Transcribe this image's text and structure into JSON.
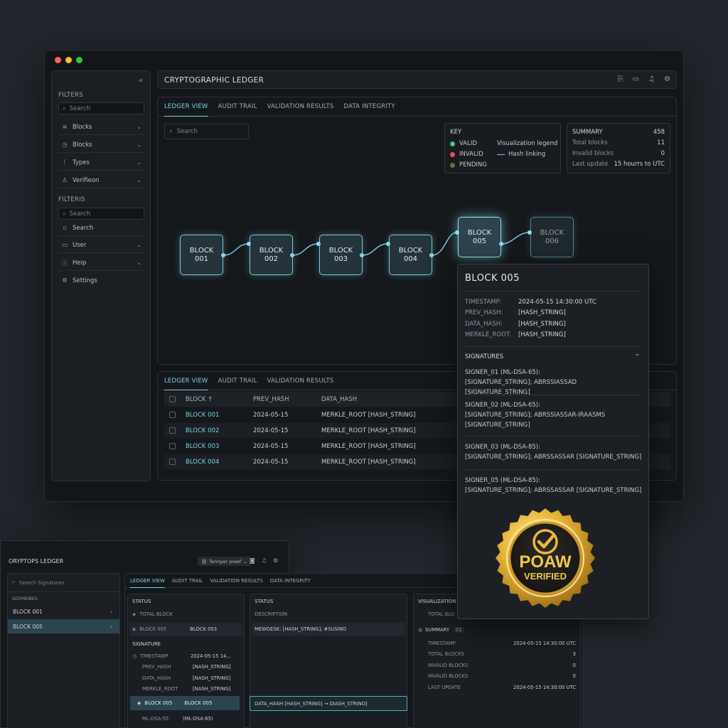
{
  "main": {
    "app_title": "CRYPTOGRAPHIC LEDGER",
    "sidebar": {
      "filters_label": "FILTERS",
      "search_placeholder": "Search",
      "items": [
        {
          "label": "Blocks",
          "icon": "stack-icon"
        },
        {
          "label": "Blocks",
          "icon": "clock-icon"
        },
        {
          "label": "Types",
          "icon": "branch-icon"
        },
        {
          "label": "Verifieon",
          "icon": "user-icon"
        }
      ],
      "filters2_label": "FILTERIS",
      "search2_placeholder": "Search",
      "search_item": "Search",
      "items2": [
        {
          "label": "User",
          "icon": "folder-icon"
        },
        {
          "label": "Heip",
          "icon": "help-icon"
        },
        {
          "label": "Settings",
          "icon": "gear-icon"
        }
      ]
    },
    "tabs": [
      "LEDGER VIEW",
      "AUDIT TRAIL",
      "VALIDATION RESULTS",
      "DATA INTEGRITY"
    ],
    "graph_search_placeholder": "Search",
    "key": {
      "title": "KEY",
      "valid": "VALID",
      "invalid": "INVALID",
      "pending": "PENDING",
      "legend": "Visualization legend",
      "hash_linking": "Hash linking",
      "colors": {
        "valid": "#4fbf94",
        "invalid": "#d9565a",
        "pending": "#6f6a3e"
      }
    },
    "summary": {
      "title": "SUMMARY",
      "title_value": "458",
      "rows": [
        {
          "label": "Total blocks",
          "value": "11"
        },
        {
          "label": "Invalid blocks",
          "value": "0"
        },
        {
          "label": "Last update",
          "value": "15 hourrs to UTC"
        }
      ]
    },
    "blocks": [
      {
        "line1": "BLOCK",
        "line2": "001"
      },
      {
        "line1": "BLOCK",
        "line2": "002"
      },
      {
        "line1": "BLOCK",
        "line2": "003"
      },
      {
        "line1": "BLOCK",
        "line2": "004"
      },
      {
        "line1": "BLOCK",
        "line2": "005"
      },
      {
        "line1": "BLOCK",
        "line2": "006"
      }
    ],
    "table": {
      "tabs": [
        "LEDGER VIEW",
        "AUDIT TRAIL",
        "VALIDATION RESULTS"
      ],
      "headers": [
        "BLOCK",
        "PREV_HASH",
        "DATA_HASH"
      ],
      "sort_glyph": "↑",
      "rows": [
        {
          "block": "BLOCK 001",
          "prev": "2024-05-15",
          "data": "MERKLE_ROOT [HASH_STRING]"
        },
        {
          "block": "BLOCK 002",
          "prev": "2024-05-15",
          "data": "MERKLE_ROOT [HASH_STRING]"
        },
        {
          "block": "BLOCK 003",
          "prev": "2024-05-15",
          "data": "MERKLE_ROOT [HASH_STRING]"
        },
        {
          "block": "BLOCK 004",
          "prev": "2024-05-15",
          "data": "MERKLE_ROOT [HASH_STRING]"
        }
      ]
    }
  },
  "detail": {
    "title": "BLOCK 005",
    "fields": [
      {
        "key": "TIMESTAMP:",
        "value": "2024-05-15 14:30:00 UTC"
      },
      {
        "key": "PREV_HASH:",
        "value": "[HASH_STRING]"
      },
      {
        "key": "DATA_HASH:",
        "value": "[HASH_STRING]"
      },
      {
        "key": "MERKLE_ROOT:",
        "value": "[HASH_STRING]"
      }
    ],
    "signatures_label": "SIGNATURES",
    "signers": [
      {
        "name": "SIGNER_01 (ML-DSA-65):",
        "sig": "[SIGNATURE_STRING]; ABRSSIASSAD [SIGNATURE_STRING]"
      },
      {
        "name": "SIGNER_02 (ML-DSA-65):",
        "sig": "[SIGNATURE_STRING]; ABRSSIASSAR-IRAASMS [SIGNATURE_STRING]"
      },
      {
        "name": "SIGNER_03 (ML-DSA-85):",
        "sig": "[SIGNATURE_STRING]; ABRSSASSAR [SIGNATURE_STRING]"
      },
      {
        "name": "SIGNER_05 (ML-DSA-85):",
        "sig": "[SIGNATURE_STRING]; ABRSSASSAR [SIGNATURE_STRING]"
      }
    ],
    "seal_line1": "POAW",
    "seal_line2": "VERIFIED"
  },
  "second": {
    "title": "ORYPTOPS LEDGER",
    "pill": "Tennper preef",
    "search_placeholder": "Search Signatures",
    "label": "SGYMDBES",
    "items": [
      {
        "label": "BLOCK 001"
      },
      {
        "label": "BLOCK 005"
      }
    ],
    "tabs": [
      "LEDGER VIEW",
      "AUDIT TRAIL",
      "VALIDATION RESULTS",
      "DATA INTEGRITY"
    ],
    "col1": {
      "title": "STATUS",
      "total_block": "TOTAL BLOCK",
      "block_005": "BLOCK 005",
      "block_003": "BLOCK 003",
      "signature": "SIGNATURE",
      "rows": [
        {
          "k": "TIMESTAWP",
          "v": "2024-05-15 14..."
        },
        {
          "k": "PREV_HASH",
          "v": "[NASH_STRING]"
        },
        {
          "k": "DATA_HASH",
          "v": "[NASH_STRING]"
        },
        {
          "k": "MERKLE_ROOT",
          "v": "[NASH_STRING]"
        }
      ],
      "sel_a": "BLOCK 005",
      "sel_b": "BLOCK 005",
      "bottom_k": "ML-DSA-55",
      "bottom_v": "(ML-DSA-65)"
    },
    "col2": {
      "title": "STATUS",
      "desc": "DESCRIPTION",
      "row": "MEWGESK: [HASH_STRING]; #SUSING",
      "box": "DATA_HASH [HASH_STRING] → DIASH_STRINO]"
    },
    "col3": {
      "title": "VISUALIZATION",
      "total": "TOTAL BLO",
      "summary": "SUMMARY",
      "summary_count": "01",
      "rows": [
        {
          "k": "TIMESTAMP",
          "v": "2024-05-15 14:30:00 UTC"
        },
        {
          "k": "TOTAL BLOCKS",
          "v": "3"
        },
        {
          "k": "INVALID BLOCKS",
          "v": "0"
        },
        {
          "k": "INVALID BLOCKS",
          "v": "0"
        },
        {
          "k": "LAST UPDATE",
          "v": "2024-05-15 14:30:00 UTC"
        }
      ]
    }
  }
}
